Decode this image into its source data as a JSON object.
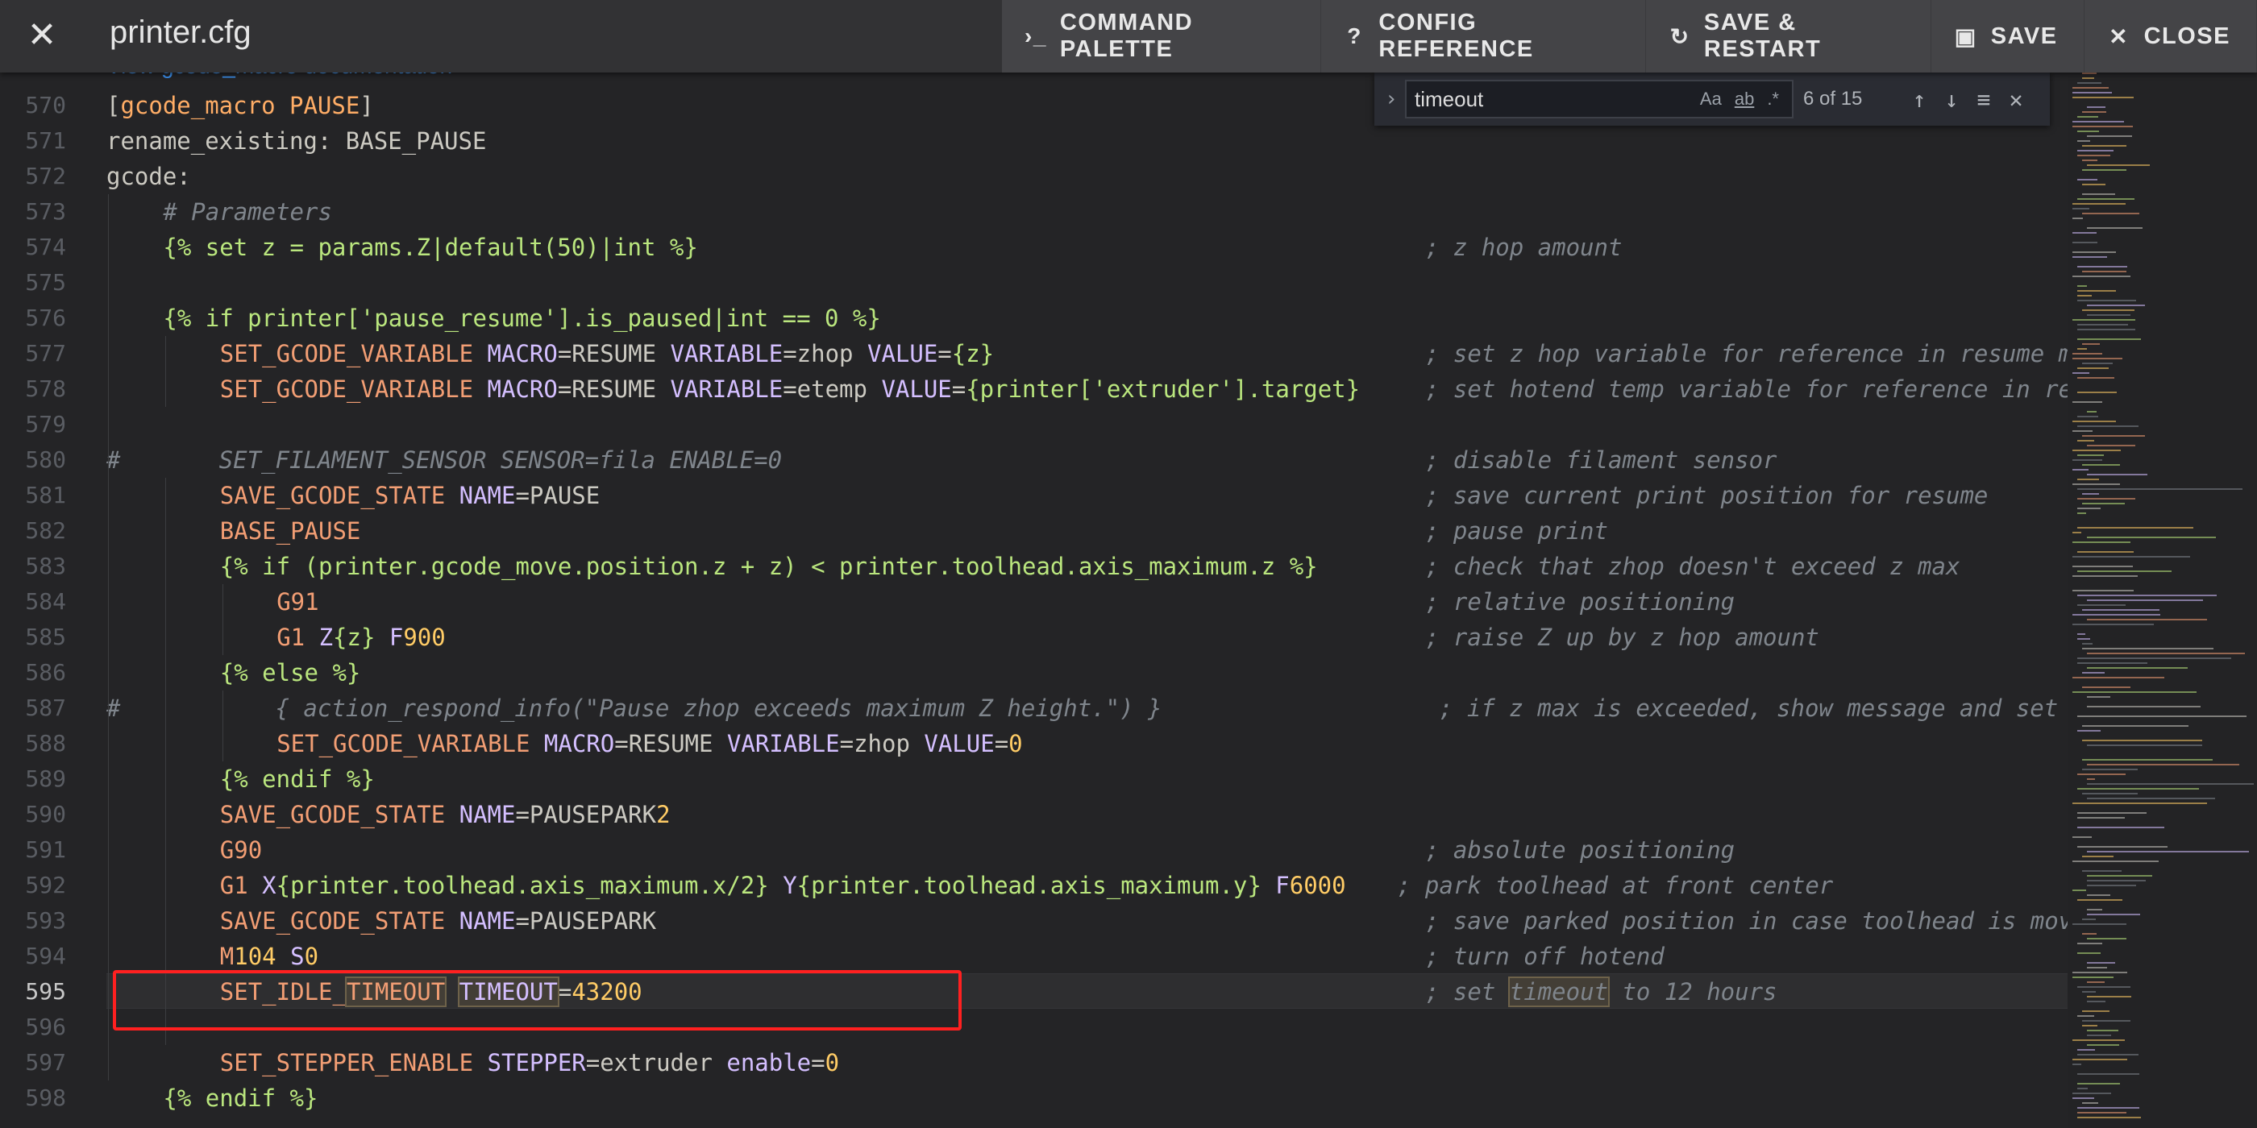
{
  "header": {
    "close_icon": "close-icon",
    "title": "printer.cfg",
    "actions": [
      {
        "icon": "terminal-icon",
        "glyph": "›_",
        "label": "COMMAND PALETTE"
      },
      {
        "icon": "help-circle-icon",
        "glyph": "?",
        "label": "CONFIG REFERENCE"
      },
      {
        "icon": "restart-icon",
        "glyph": "↻",
        "label": "SAVE & RESTART"
      },
      {
        "icon": "floppy-icon",
        "glyph": "▣",
        "label": "SAVE"
      },
      {
        "icon": "close-icon",
        "glyph": "✕",
        "label": "CLOSE"
      }
    ]
  },
  "doc_link": "View gcode_macro documentation",
  "find": {
    "value": "timeout",
    "match_case": "Aa",
    "whole_word": "ab",
    "regex": ".*",
    "count": "6 of 15"
  },
  "colors": {
    "command": "#f29e74",
    "param": "#d4bfff",
    "number": "#ffcc66",
    "jinja": "#bae67e",
    "comment": "#7f858c",
    "highlight": "#ff2020"
  },
  "current_line": 595,
  "lines": [
    {
      "n": 570,
      "i": 0,
      "tok": [
        [
          "t",
          "["
        ],
        [
          "s",
          "gcode_macro PAUSE"
        ],
        [
          "t",
          "]"
        ]
      ]
    },
    {
      "n": 571,
      "i": 0,
      "tok": [
        [
          "t",
          "rename_existing: BASE_PAUSE"
        ]
      ]
    },
    {
      "n": 572,
      "i": 0,
      "tok": [
        [
          "t",
          "gcode:"
        ]
      ]
    },
    {
      "n": 573,
      "i": 1,
      "tok": [
        [
          "c",
          "# Parameters"
        ]
      ]
    },
    {
      "n": 574,
      "i": 1,
      "tok": [
        [
          "j",
          "{% set z = params.Z|default(50)|int %}"
        ]
      ],
      "cm": "; z hop amount"
    },
    {
      "n": 575,
      "i": 0,
      "tok": []
    },
    {
      "n": 576,
      "i": 1,
      "tok": [
        [
          "j",
          "{% if printer['pause_resume'].is_paused|int == 0 %}"
        ]
      ]
    },
    {
      "n": 577,
      "i": 2,
      "tok": [
        [
          "k",
          "SET_GCODE_VARIABLE"
        ],
        [
          "p",
          " MACRO"
        ],
        [
          "t",
          "=RESUME "
        ],
        [
          "p",
          "VARIABLE"
        ],
        [
          "t",
          "=zhop "
        ],
        [
          "p",
          "VALUE"
        ],
        [
          "t",
          "="
        ],
        [
          "j",
          "{z}"
        ]
      ],
      "cm": "; set z hop variable for reference in resume m"
    },
    {
      "n": 578,
      "i": 2,
      "tok": [
        [
          "k",
          "SET_GCODE_VARIABLE"
        ],
        [
          "p",
          " MACRO"
        ],
        [
          "t",
          "=RESUME "
        ],
        [
          "p",
          "VARIABLE"
        ],
        [
          "t",
          "=etemp "
        ],
        [
          "p",
          "VALUE"
        ],
        [
          "t",
          "="
        ],
        [
          "j",
          "{printer['extruder'].target}"
        ]
      ],
      "cm": "; set hotend temp variable for reference in re"
    },
    {
      "n": 579,
      "i": 0,
      "tok": []
    },
    {
      "n": 580,
      "i": 0,
      "tok": [
        [
          "c",
          "#       SET_FILAMENT_SENSOR SENSOR=fila ENABLE=0"
        ]
      ],
      "cm": "; disable filament sensor"
    },
    {
      "n": 581,
      "i": 2,
      "tok": [
        [
          "k",
          "SAVE_GCODE_STATE"
        ],
        [
          "p",
          " NAME"
        ],
        [
          "t",
          "=PAUSE"
        ]
      ],
      "cm": "; save current print position for resume"
    },
    {
      "n": 582,
      "i": 2,
      "tok": [
        [
          "k",
          "BASE_PAUSE"
        ]
      ],
      "cm": "; pause print"
    },
    {
      "n": 583,
      "i": 2,
      "tok": [
        [
          "j",
          "{% if (printer.gcode_move.position.z + z) < printer.toolhead.axis_maximum.z %}"
        ]
      ],
      "cm": "; check that zhop doesn't exceed z max"
    },
    {
      "n": 584,
      "i": 3,
      "tok": [
        [
          "k",
          "G91"
        ]
      ],
      "cm": "; relative positioning"
    },
    {
      "n": 585,
      "i": 3,
      "tok": [
        [
          "k",
          "G1"
        ],
        [
          "p",
          " Z"
        ],
        [
          "j",
          "{z}"
        ],
        [
          "p",
          " F"
        ],
        [
          "n",
          "900"
        ]
      ],
      "cm": "; raise Z up by z hop amount"
    },
    {
      "n": 586,
      "i": 2,
      "tok": [
        [
          "j",
          "{% else %}"
        ]
      ]
    },
    {
      "n": 587,
      "i": 0,
      "tok": [
        [
          "c",
          "#           { action_respond_info(\"Pause zhop exceeds maximum Z height.\") }"
        ]
      ],
      "cm": "; if z max is exceeded, show message and set"
    },
    {
      "n": 588,
      "i": 3,
      "tok": [
        [
          "k",
          "SET_GCODE_VARIABLE"
        ],
        [
          "p",
          " MACRO"
        ],
        [
          "t",
          "=RESUME "
        ],
        [
          "p",
          "VARIABLE"
        ],
        [
          "t",
          "=zhop "
        ],
        [
          "p",
          "VALUE"
        ],
        [
          "t",
          "="
        ],
        [
          "n",
          "0"
        ]
      ]
    },
    {
      "n": 589,
      "i": 2,
      "tok": [
        [
          "j",
          "{% endif %}"
        ]
      ]
    },
    {
      "n": 590,
      "i": 2,
      "tok": [
        [
          "k",
          "SAVE_GCODE_STATE"
        ],
        [
          "p",
          " NAME"
        ],
        [
          "t",
          "=PAUSEPARK"
        ],
        [
          "n",
          "2"
        ]
      ]
    },
    {
      "n": 591,
      "i": 2,
      "tok": [
        [
          "k",
          "G90"
        ]
      ],
      "cm": "; absolute positioning"
    },
    {
      "n": 592,
      "i": 2,
      "tok": [
        [
          "k",
          "G1"
        ],
        [
          "p",
          " X"
        ],
        [
          "j",
          "{printer.toolhead.axis_maximum.x/2}"
        ],
        [
          "p",
          " Y"
        ],
        [
          "j",
          "{printer.toolhead.axis_maximum.y}"
        ],
        [
          "p",
          " F"
        ],
        [
          "n",
          "6000"
        ]
      ],
      "cm": "; park toolhead at front center"
    },
    {
      "n": 593,
      "i": 2,
      "tok": [
        [
          "k",
          "SAVE_GCODE_STATE"
        ],
        [
          "p",
          " NAME"
        ],
        [
          "t",
          "=PAUSEPARK"
        ]
      ],
      "cm": "; save parked position in case toolhead is mov"
    },
    {
      "n": 594,
      "i": 2,
      "tok": [
        [
          "k",
          "M"
        ],
        [
          "n",
          "104"
        ],
        [
          "p",
          " S"
        ],
        [
          "n",
          "0"
        ]
      ],
      "cm": "; turn off hotend"
    },
    {
      "n": 595,
      "i": 2,
      "tok": [
        [
          "k",
          "SET_IDLE_"
        ],
        [
          "kh",
          "TIMEOUT"
        ],
        [
          "t",
          " "
        ],
        [
          "ph",
          "TIMEOUT"
        ],
        [
          "t",
          "="
        ],
        [
          "n",
          "43200"
        ]
      ],
      "cmtok": [
        [
          "c",
          "; set "
        ],
        [
          "ch",
          "timeout"
        ],
        [
          "c",
          " to 12 hours"
        ]
      ]
    },
    {
      "n": 596,
      "i": 0,
      "tok": []
    },
    {
      "n": 597,
      "i": 2,
      "tok": [
        [
          "k",
          "SET_STEPPER_ENABLE"
        ],
        [
          "p",
          " STEPPER"
        ],
        [
          "t",
          "=extruder"
        ],
        [
          "p",
          " enable"
        ],
        [
          "t",
          "="
        ],
        [
          "n",
          "0"
        ]
      ]
    },
    {
      "n": 598,
      "i": 1,
      "tok": [
        [
          "j",
          "{% endif %}"
        ]
      ]
    }
  ]
}
